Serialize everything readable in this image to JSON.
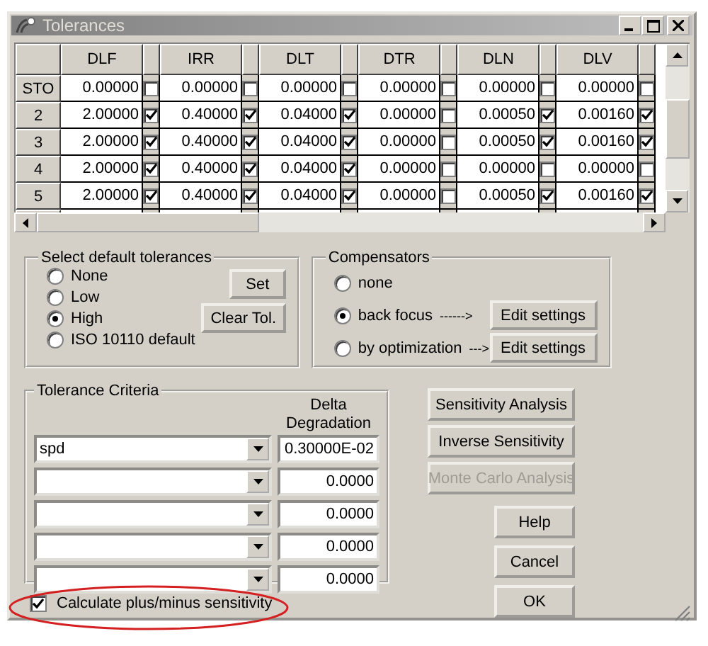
{
  "window": {
    "title": "Tolerances"
  },
  "table": {
    "columns": [
      "DLF",
      "IRR",
      "DLT",
      "DTR",
      "DLN",
      "DLV"
    ],
    "rows": [
      {
        "label": "STO",
        "cells": [
          {
            "value": "0.00000",
            "checked": false
          },
          {
            "value": "0.00000",
            "checked": false
          },
          {
            "value": "0.00000",
            "checked": false
          },
          {
            "value": "0.00000",
            "checked": false
          },
          {
            "value": "0.00000",
            "checked": false
          },
          {
            "value": "0.00000",
            "checked": false
          }
        ]
      },
      {
        "label": "2",
        "cells": [
          {
            "value": "2.00000",
            "checked": true
          },
          {
            "value": "0.40000",
            "checked": true
          },
          {
            "value": "0.04000",
            "checked": true
          },
          {
            "value": "0.00000",
            "checked": false
          },
          {
            "value": "0.00050",
            "checked": true
          },
          {
            "value": "0.00160",
            "checked": true
          }
        ]
      },
      {
        "label": "3",
        "cells": [
          {
            "value": "2.00000",
            "checked": true
          },
          {
            "value": "0.40000",
            "checked": true
          },
          {
            "value": "0.04000",
            "checked": true
          },
          {
            "value": "0.00000",
            "checked": false
          },
          {
            "value": "0.00050",
            "checked": true
          },
          {
            "value": "0.00160",
            "checked": true
          }
        ]
      },
      {
        "label": "4",
        "cells": [
          {
            "value": "2.00000",
            "checked": true
          },
          {
            "value": "0.40000",
            "checked": true
          },
          {
            "value": "0.04000",
            "checked": true
          },
          {
            "value": "0.00000",
            "checked": false
          },
          {
            "value": "0.00000",
            "checked": false
          },
          {
            "value": "0.00000",
            "checked": false
          }
        ]
      },
      {
        "label": "5",
        "cells": [
          {
            "value": "2.00000",
            "checked": true
          },
          {
            "value": "0.40000",
            "checked": true
          },
          {
            "value": "0.04000",
            "checked": true
          },
          {
            "value": "0.00000",
            "checked": false
          },
          {
            "value": "0.00050",
            "checked": true
          },
          {
            "value": "0.00160",
            "checked": true
          }
        ]
      }
    ]
  },
  "default_tolerances": {
    "title": "Select default tolerances",
    "options": [
      {
        "label": "None",
        "selected": false
      },
      {
        "label": "Low",
        "selected": false
      },
      {
        "label": "High",
        "selected": true
      },
      {
        "label": "ISO 10110 default",
        "selected": false
      }
    ],
    "buttons": [
      "Set",
      "Clear Tol."
    ]
  },
  "compensators": {
    "title": "Compensators",
    "options": [
      {
        "label": "none",
        "selected": false
      },
      {
        "label": "back focus",
        "selected": true,
        "arrow": "------>",
        "button": "Edit settings"
      },
      {
        "label": "by optimization",
        "selected": false,
        "arrow": "--->",
        "button": "Edit settings"
      }
    ]
  },
  "tolerance_criteria": {
    "title": "Tolerance Criteria",
    "value_heading": "Delta Degradation",
    "rows": [
      {
        "criterion": "spd",
        "value": "0.30000E-02"
      },
      {
        "value": "0.0000"
      },
      {
        "value": "0.0000"
      },
      {
        "value": "0.0000"
      },
      {
        "value": "0.0000"
      }
    ]
  },
  "actions": [
    {
      "label": "Sensitivity Analysis",
      "disabled": false
    },
    {
      "label": "Inverse Sensitivity",
      "disabled": false
    },
    {
      "label": "Monte Carlo Analysis",
      "disabled": true
    }
  ],
  "dialog_buttons": [
    "Help",
    "Cancel",
    "OK"
  ],
  "plus_minus": {
    "label": "Calculate plus/minus sensitivity",
    "checked": true
  }
}
